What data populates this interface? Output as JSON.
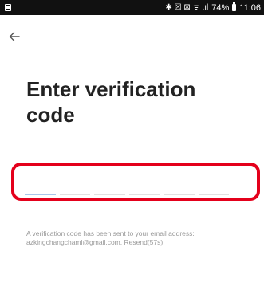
{
  "status_bar": {
    "signal_icons": "✱ ☒ ⊠ ᯤ .ıl",
    "battery_percent": "74%",
    "time": "11:06"
  },
  "header": {
    "back_icon": "arrow-left-icon",
    "title": "Enter verification code"
  },
  "code_input": {
    "length": 6,
    "active_index": 0,
    "values": [
      "",
      "",
      "",
      "",
      "",
      ""
    ],
    "highlight_color": "#e4001b",
    "active_underline_color": "#a9c6ea"
  },
  "hint": {
    "text": "A verification code has been sent to your email address: azkingchangchaml@gmail.com,",
    "resend": "Resend(57s)"
  }
}
